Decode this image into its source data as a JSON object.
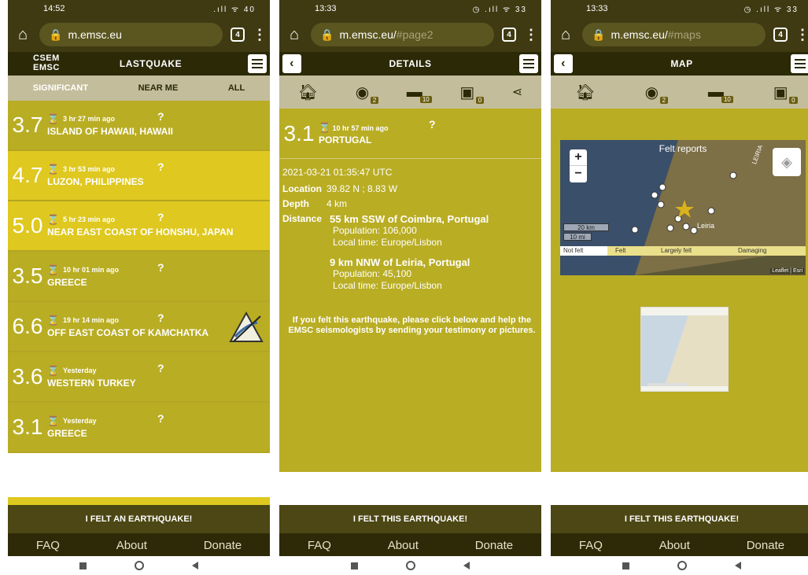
{
  "phone1": {
    "status": {
      "time": "14:52",
      "icons": ".ıll ᯤ 40"
    },
    "url": {
      "host": "m.emsc.eu",
      "hash": "",
      "tabs": "4"
    },
    "header": {
      "logo_top": "CSEM",
      "logo_bottom": "EMSC",
      "title": "LASTQUAKE"
    },
    "filters": [
      "SIGNIFICANT",
      "NEAR ME",
      "ALL"
    ],
    "quakes": [
      {
        "mag": "3.7",
        "time": "3 hr 27 min ago",
        "region": "ISLAND OF HAWAII, HAWAII",
        "style": "sig"
      },
      {
        "mag": "4.7",
        "time": "3 hr 53 min ago",
        "region": "LUZON, PHILIPPINES",
        "style": "bright"
      },
      {
        "mag": "5.0",
        "time": "5 hr 23 min ago",
        "region": "NEAR EAST COAST OF HONSHU, JAPAN",
        "style": "bright"
      },
      {
        "mag": "3.5",
        "time": "10 hr 01 min ago",
        "region": "GREECE",
        "style": "sig"
      },
      {
        "mag": "6.6",
        "time": "19 hr 14 min ago",
        "region": "OFF EAST COAST OF KAMCHATKA",
        "style": "sig"
      },
      {
        "mag": "3.6",
        "time": "Yesterday",
        "region": "WESTERN TURKEY",
        "style": "sig"
      },
      {
        "mag": "3.1",
        "time": "Yesterday",
        "region": "GREECE",
        "style": "sig"
      }
    ],
    "felt_button": "I FELT AN EARTHQUAKE!"
  },
  "phone2": {
    "status": {
      "time": "13:33",
      "icons": "◷ .ıll ᯤ 33"
    },
    "url": {
      "host": "m.emsc.eu/",
      "hash": "#page2",
      "tabs": "4"
    },
    "header": {
      "title": "DETAILS"
    },
    "badges": {
      "globe": "2",
      "comments": "10",
      "pictures": "0"
    },
    "quake": {
      "mag": "3.1",
      "time": "10 hr 57 min ago",
      "region": "PORTUGAL"
    },
    "datetime": "2021-03-21   01:35:47 UTC",
    "location_label": "Location",
    "location": "39.82 N ; 8.83 W",
    "depth_label": "Depth",
    "depth": "4 km",
    "distance_label": "Distance",
    "distances": [
      {
        "place": "55 km SSW of Coimbra, Portugal",
        "population": "Population: 106,000",
        "localtime": "Local time: Europe/Lisbon"
      },
      {
        "place": "9 km NNW of Leiria, Portugal",
        "population": "Population: 45,100",
        "localtime": "Local time: Europe/Lisbon"
      }
    ],
    "help": "If you felt this earthquake, please click below and help the EMSC seismologists by sending your testimony or pictures.",
    "felt_button": "I FELT THIS EARTHQUAKE!"
  },
  "phone3": {
    "status": {
      "time": "13:33",
      "icons": "◷ .ıll ᯤ 33"
    },
    "url": {
      "host": "m.emsc.eu/",
      "hash": "#maps",
      "tabs": "4"
    },
    "header": {
      "title": "MAP"
    },
    "badges": {
      "globe": "2",
      "comments": "10",
      "pictures": "0"
    },
    "map": {
      "title": "Felt reports",
      "scale_km": "20 km",
      "scale_mi": "10 mi",
      "place": "Leiria",
      "region_label": "LEIRIA",
      "legend": [
        "Not felt",
        "Felt",
        "Largely felt",
        "Damaging"
      ],
      "attribution": "Leaflet | Esri",
      "zoom_in": "+",
      "zoom_out": "−"
    },
    "felt_button": "I FELT THIS EARTHQUAKE!"
  },
  "footer": {
    "faq": "FAQ",
    "about": "About",
    "donate": "Donate"
  },
  "colors": {
    "dark": "#2b2906",
    "olive": "#b9ad24",
    "bright": "#dfc81f",
    "gray": "#c3bd9c"
  }
}
